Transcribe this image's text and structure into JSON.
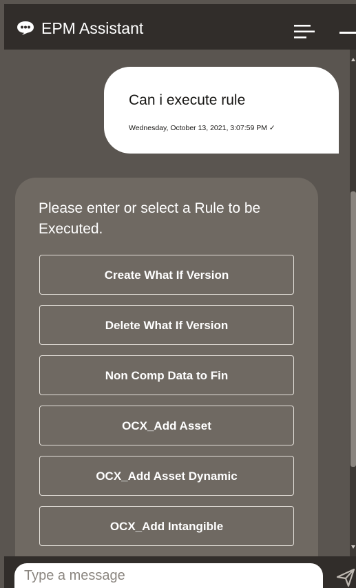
{
  "header": {
    "title": "EPM Assistant",
    "icons": [
      "chat-bubble-icon",
      "menu-icon",
      "minimize-icon"
    ]
  },
  "conversation": {
    "user_message": {
      "text": "Can i execute rule",
      "timestamp": "Wednesday, October 13, 2021, 3:07:59 PM ✓"
    },
    "bot_message": {
      "text": "Please enter or select a Rule to be Executed.",
      "options": [
        "Create What If Version",
        "Delete What If Version",
        "Non Comp Data to Fin",
        "OCX_Add Asset",
        "OCX_Add Asset Dynamic",
        "OCX_Add Intangible"
      ]
    }
  },
  "footer": {
    "input_placeholder": "Type a message",
    "input_value": "",
    "send_icon": "send-icon"
  },
  "colors": {
    "header_bg": "#312d2a",
    "conversation_bg": "#5a5550",
    "bot_bubble_bg": "#6f6962",
    "user_bubble_bg": "#ffffff",
    "text_light": "#ffffff",
    "text_dark": "#161513"
  }
}
